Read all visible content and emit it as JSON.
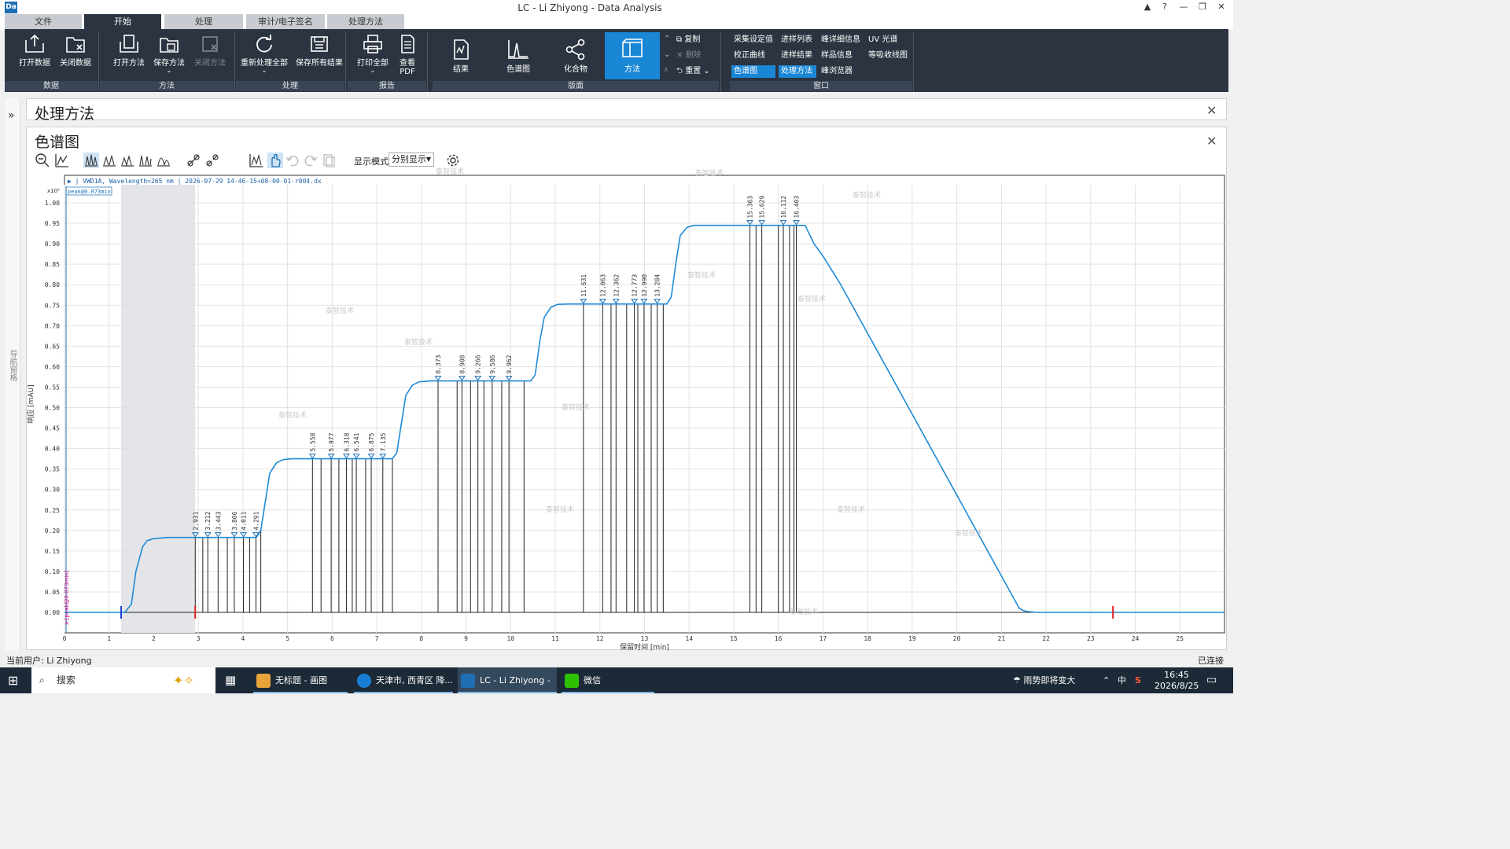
{
  "window": {
    "logo": "Da",
    "title": "LC - Li Zhiyong - Data Analysis",
    "buttons": {
      "pin": "▲",
      "help": "?",
      "minimize": "—",
      "restore": "❐",
      "close": "✕"
    }
  },
  "menu_tabs": [
    {
      "label": "文件",
      "active": false
    },
    {
      "label": "开始",
      "active": true
    },
    {
      "label": "处理",
      "active": false
    },
    {
      "label": "审计/电子签名",
      "active": false
    },
    {
      "label": "处理方法",
      "active": false
    }
  ],
  "ribbon": {
    "groups": {
      "data": "数据",
      "method": "方法",
      "process": "处理",
      "report": "报告",
      "layout": "版面",
      "window": "窗口"
    },
    "buttons": {
      "open_data": "打开数据",
      "close_data": "关闭数据",
      "open_method": "打开方法",
      "save_method": "保存方法",
      "close_method": "关闭方法",
      "reprocess_all": "重新处理全部",
      "save_all_results": "保存所有结果",
      "print_all": "打印全部",
      "view_pdf": "查看\nPDF",
      "view_pdf_line1": "查看",
      "view_pdf_line2": "PDF"
    },
    "layout_buttons": [
      {
        "label": "结果",
        "active": false
      },
      {
        "label": "色谱图",
        "active": false
      },
      {
        "label": "化合物",
        "active": false
      },
      {
        "label": "方法",
        "active": true
      }
    ],
    "small_actions": {
      "copy": "复制",
      "delete": "删除",
      "reset": "重置"
    },
    "window_links": [
      {
        "label": "采集设定值",
        "active": false
      },
      {
        "label": "进样列表",
        "active": false
      },
      {
        "label": "峰详细信息",
        "active": false
      },
      {
        "label": "UV 光谱",
        "active": false
      },
      {
        "label": "校正曲线",
        "active": false
      },
      {
        "label": "进样结果",
        "active": false
      },
      {
        "label": "样品信息",
        "active": false
      },
      {
        "label": "等吸收线图",
        "active": false
      },
      {
        "label": "色谱图",
        "active": true
      },
      {
        "label": "处理方法",
        "active": true
      },
      {
        "label": "峰浏览器",
        "active": false
      }
    ]
  },
  "sidebar": {
    "label": "导航窗格",
    "expand_icon": "»"
  },
  "method_panel": {
    "title": "处理方法"
  },
  "chromatogram_panel": {
    "title": "色谱图",
    "display_mode_label": "显示模式",
    "display_mode_value": "分别显示"
  },
  "watermark": "泰智技术",
  "chart_data": {
    "type": "line",
    "trace_label": "VWD1A, Wavelength=265 nm | 2026-07-29 14-46-15+08-00-01-r004.dx",
    "cursor_label": "peak@0.073min",
    "side_label": "x-[peak@0.073min]",
    "y_exponent": "x10³",
    "xlabel": "保留时间 [min]",
    "ylabel": "响应 [mAU]",
    "xlim": [
      0,
      26
    ],
    "ylim": [
      0,
      1.0
    ],
    "x_ticks": [
      0,
      1,
      2,
      3,
      4,
      5,
      6,
      7,
      8,
      9,
      10,
      11,
      12,
      13,
      14,
      15,
      16,
      17,
      18,
      19,
      20,
      21,
      22,
      23,
      24,
      25
    ],
    "y_ticks": [
      "0.00",
      "0.05",
      "0.10",
      "0.15",
      "0.20",
      "0.25",
      "0.30",
      "0.35",
      "0.40",
      "0.45",
      "0.50",
      "0.55",
      "0.60",
      "0.65",
      "0.70",
      "0.75",
      "0.80",
      "0.85",
      "0.90",
      "0.95",
      "1.00"
    ],
    "shaded_region": [
      1.27,
      2.93
    ],
    "series": [
      {
        "x": [
          0,
          1.35,
          1.5,
          1.6,
          1.75,
          1.85,
          2.0,
          2.3,
          4.3,
          4.4,
          4.5,
          4.6,
          4.75,
          4.9,
          5.1,
          7.35,
          7.45,
          7.55,
          7.65,
          7.8,
          7.95,
          8.2,
          10.45,
          10.55,
          10.65,
          10.75,
          10.9,
          11.05,
          11.3,
          13.5,
          13.6,
          13.7,
          13.8,
          13.95,
          14.1,
          14.35,
          16.6,
          16.8,
          17.0,
          17.4,
          21.4,
          21.5,
          21.6,
          21.8,
          26
        ],
        "y": [
          0,
          0,
          0.02,
          0.1,
          0.16,
          0.175,
          0.18,
          0.183,
          0.183,
          0.2,
          0.27,
          0.34,
          0.365,
          0.373,
          0.375,
          0.375,
          0.39,
          0.46,
          0.53,
          0.555,
          0.563,
          0.565,
          0.565,
          0.58,
          0.66,
          0.72,
          0.745,
          0.752,
          0.753,
          0.753,
          0.77,
          0.85,
          0.92,
          0.94,
          0.945,
          0.945,
          0.945,
          0.9,
          0.87,
          0.8,
          0.01,
          0.004,
          0.002,
          0,
          0
        ]
      }
    ],
    "peaks": [
      {
        "rt": 2.931,
        "label": "2.931",
        "y": 0.183
      },
      {
        "rt": 3.212,
        "label": "3.212",
        "y": 0.183
      },
      {
        "rt": 3.443,
        "label": "3.443",
        "y": 0.183
      },
      {
        "rt": 3.806,
        "label": "3.806",
        "y": 0.183
      },
      {
        "rt": 4.011,
        "label": "4.011",
        "y": 0.183
      },
      {
        "rt": 4.291,
        "label": "4.291",
        "y": 0.183
      },
      {
        "rt": 5.558,
        "label": "5.558",
        "y": 0.375
      },
      {
        "rt": 5.977,
        "label": "5.977",
        "y": 0.375
      },
      {
        "rt": 6.318,
        "label": "6.318",
        "y": 0.375
      },
      {
        "rt": 6.541,
        "label": "6.541",
        "y": 0.375
      },
      {
        "rt": 6.875,
        "label": "6.875",
        "y": 0.375
      },
      {
        "rt": 7.135,
        "label": "7.135",
        "y": 0.375
      },
      {
        "rt": 8.373,
        "label": "8.373",
        "y": 0.565
      },
      {
        "rt": 8.908,
        "label": "8.908",
        "y": 0.565
      },
      {
        "rt": 9.266,
        "label": "9.266",
        "y": 0.565
      },
      {
        "rt": 9.586,
        "label": "9.586",
        "y": 0.565
      },
      {
        "rt": 9.962,
        "label": "9.962",
        "y": 0.565
      },
      {
        "rt": 11.631,
        "label": "11.631",
        "y": 0.753
      },
      {
        "rt": 12.063,
        "label": "12.063",
        "y": 0.753
      },
      {
        "rt": 12.362,
        "label": "12.362",
        "y": 0.753
      },
      {
        "rt": 12.773,
        "label": "12.773",
        "y": 0.753
      },
      {
        "rt": 12.99,
        "label": "12.990",
        "y": 0.753
      },
      {
        "rt": 13.284,
        "label": "13.284",
        "y": 0.753
      },
      {
        "rt": 15.363,
        "label": "15.363",
        "y": 0.945
      },
      {
        "rt": 15.629,
        "label": "15.629",
        "y": 0.945
      },
      {
        "rt": 16.112,
        "label": "16.112",
        "y": 0.945
      },
      {
        "rt": 16.403,
        "label": "16.403",
        "y": 0.945
      }
    ],
    "extra_drop_lines": [
      3.1,
      3.65,
      4.15,
      4.4,
      5.75,
      6.15,
      6.45,
      6.75,
      7.35,
      8.8,
      9.1,
      9.4,
      9.8,
      10.3,
      12.25,
      12.6,
      12.85,
      13.15,
      13.42,
      15.5,
      16.0,
      16.25,
      16.35
    ],
    "tick_markers": [
      1.27,
      2.93,
      23.5
    ]
  },
  "statusbar": {
    "user": "当前用户: Li Zhiyong",
    "connection": "已连接"
  },
  "taskbar": {
    "search": "搜索",
    "apps": [
      {
        "label": "无标题 - 画图",
        "color": "#e8a33b"
      },
      {
        "label": "天津市, 西青区 降...",
        "color": "#1a7fd4"
      },
      {
        "label": "LC - Li Zhiyong - ...",
        "color": "#1f6fb5"
      },
      {
        "label": "微信",
        "color": "#2dc100"
      }
    ],
    "weather": "雨势即将变大",
    "ime": "中",
    "time": "16:45",
    "date": "2026/8/25"
  }
}
